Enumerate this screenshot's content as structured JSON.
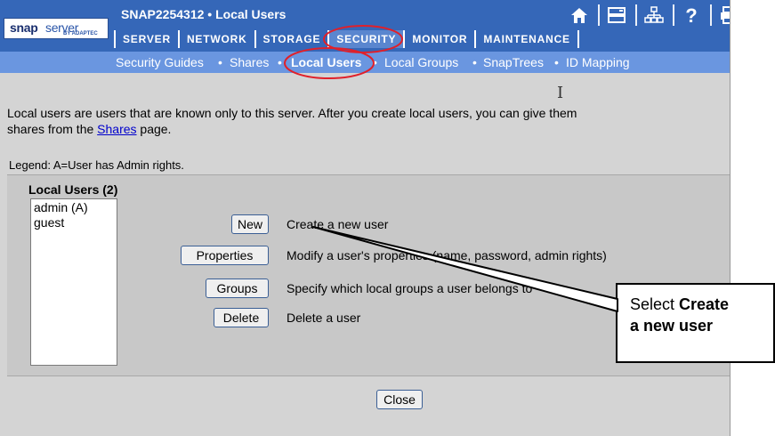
{
  "app": {
    "logo_bold": "snap",
    "logo_light": "server",
    "logo_tagline": "BY ADAPTEC",
    "page_title": "SNAP2254312 • Local Users"
  },
  "toolbar_icons": [
    "home-icon",
    "server-icon",
    "network-icon",
    "help-icon",
    "printer-icon"
  ],
  "menu": {
    "items": [
      {
        "label": "SERVER"
      },
      {
        "label": "NETWORK"
      },
      {
        "label": "STORAGE"
      },
      {
        "label": "SECURITY",
        "active": true
      },
      {
        "label": "MONITOR"
      },
      {
        "label": "MAINTENANCE"
      }
    ]
  },
  "subnav": {
    "items": [
      {
        "label": "Security Guides"
      },
      {
        "label": "Shares"
      },
      {
        "label": "Local Users",
        "current": true
      },
      {
        "label": "Local Groups"
      },
      {
        "label": "SnapTrees"
      },
      {
        "label": "ID Mapping"
      }
    ],
    "separator": "•"
  },
  "content": {
    "intro_line1": "Local users are users that are known only to this server. After you create local users, you can give them",
    "intro_line2_pre": "shares from the ",
    "intro_link": "Shares",
    "intro_line2_post": " page.",
    "legend": "Legend: A=User has Admin rights."
  },
  "users_panel": {
    "heading": "Local Users (2)",
    "users": [
      "admin (A)",
      "guest"
    ]
  },
  "actions": [
    {
      "button": "New",
      "description": "Create a new user"
    },
    {
      "button": "Properties",
      "description": "Modify a user's properties (name, password, admin rights)"
    },
    {
      "button": "Groups",
      "description": "Specify which local groups a user belongs to"
    },
    {
      "button": "Delete",
      "description": "Delete a user"
    }
  ],
  "close_button": "Close",
  "callout": {
    "prefix": "Select ",
    "bold_line1": "Create",
    "bold_line2": "a new user"
  },
  "colors": {
    "header_blue": "#3567b8",
    "subnav_blue": "#6a96e0",
    "annotation_red": "#e0202a",
    "panel_gray": "#c8c8c8"
  }
}
